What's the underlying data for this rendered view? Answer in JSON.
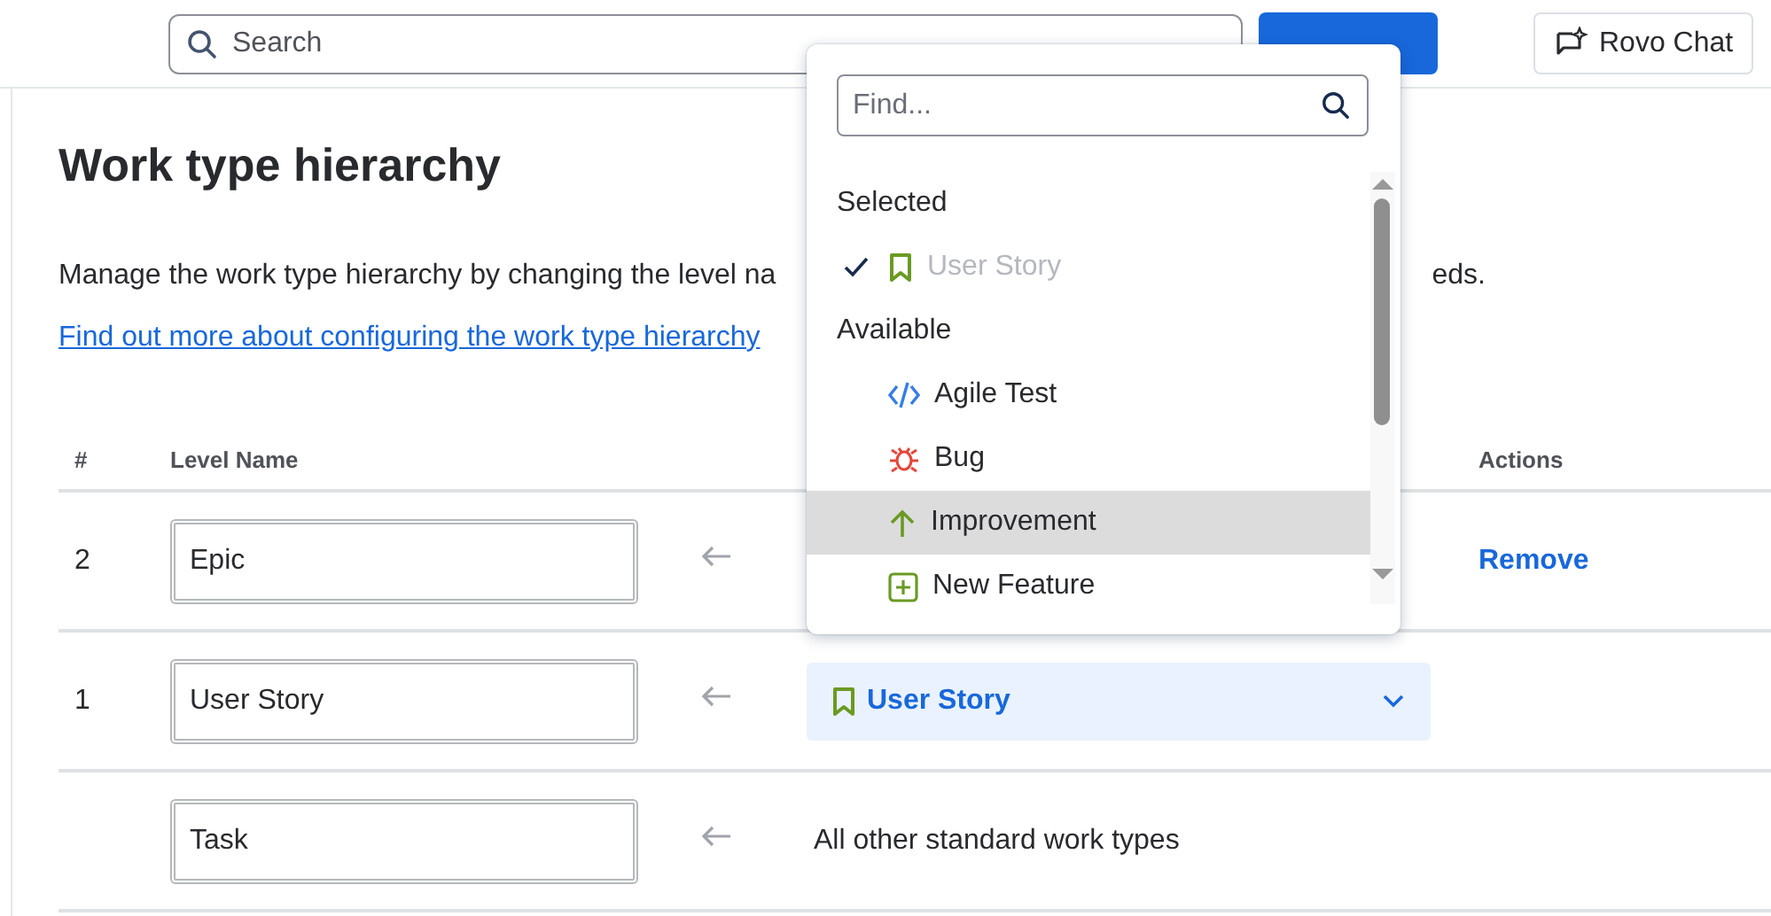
{
  "top_bar": {
    "search": {
      "placeholder": "Search"
    },
    "chat_button": "Rovo Chat"
  },
  "page": {
    "title": "Work type hierarchy",
    "description_start": "Manage the work type hierarchy by changing the level na",
    "description_end": "eds.",
    "link": "Find out more about configuring the work type hierarchy"
  },
  "table": {
    "columns": [
      "#",
      "Level Name",
      "Actions"
    ],
    "rows": [
      {
        "number": "2",
        "name": "Epic",
        "action": "Remove"
      },
      {
        "number": "1",
        "name": "User Story",
        "work_type": {
          "kind": "select",
          "label": "User Story"
        }
      },
      {
        "name": "Task",
        "work_type": {
          "kind": "text",
          "label": "All other standard work types"
        }
      }
    ]
  },
  "popover": {
    "placeholder": "Find...",
    "groups": [
      {
        "heading": "Selected",
        "items": [
          {
            "kind": "story",
            "label": "User Story",
            "checked": true,
            "disabled": true,
            "selected": false
          }
        ]
      },
      {
        "heading": "Available",
        "items": [
          {
            "kind": "test",
            "label": "Agile Test",
            "checked": false,
            "disabled": false,
            "selected": false
          },
          {
            "kind": "bug",
            "label": "Bug",
            "checked": false,
            "disabled": false,
            "selected": false
          },
          {
            "kind": "improvement",
            "label": "Improvement",
            "checked": false,
            "disabled": false,
            "selected": true
          },
          {
            "kind": "feature",
            "label": "New Feature",
            "checked": false,
            "disabled": false,
            "selected": false
          }
        ]
      }
    ]
  }
}
